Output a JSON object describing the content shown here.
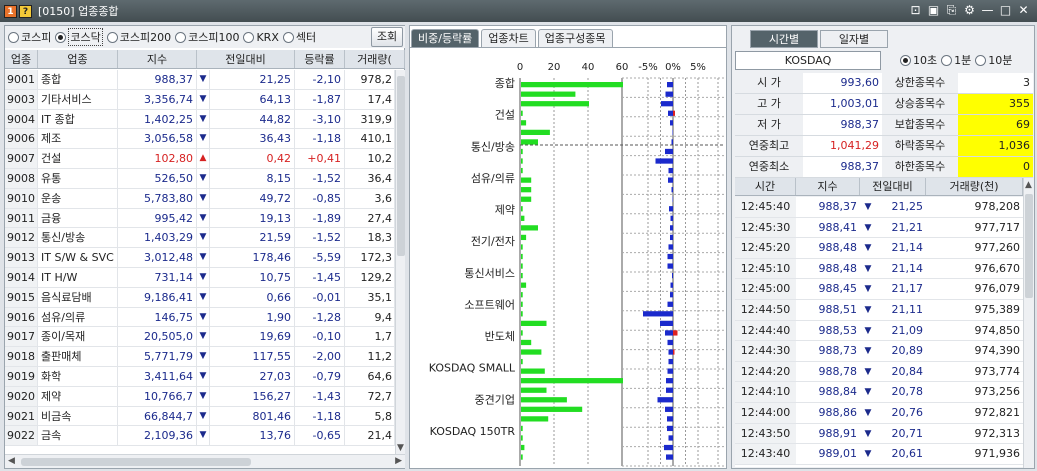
{
  "window": {
    "title": "[0150] 업종종합",
    "badge_1": "1",
    "badge_2": "?",
    "controls": [
      "⊡",
      "▣",
      "⎘",
      "⚙",
      "—",
      "□",
      "✕"
    ]
  },
  "left_panel": {
    "market_options": [
      {
        "label": "코스피",
        "selected": false
      },
      {
        "label": "코스닥",
        "selected": true
      },
      {
        "label": "코스피200",
        "selected": false
      },
      {
        "label": "코스피100",
        "selected": false
      },
      {
        "label": "KRX",
        "selected": false
      },
      {
        "label": "섹터",
        "selected": false
      }
    ],
    "query_button": "조회",
    "columns": [
      "업종",
      "업종",
      "지수",
      "전일대비",
      "등락률",
      "거래량("
    ],
    "rows": [
      {
        "code": "9001",
        "name": "종합",
        "index": "988,37",
        "dir": "down",
        "change": "21,25",
        "pct": "-2,10",
        "vol": "978,2"
      },
      {
        "code": "9003",
        "name": "기타서비스",
        "index": "3,356,74",
        "dir": "down",
        "change": "64,13",
        "pct": "-1,87",
        "vol": "17,4"
      },
      {
        "code": "9004",
        "name": "IT 종합",
        "index": "1,402,25",
        "dir": "down",
        "change": "44,82",
        "pct": "-3,10",
        "vol": "319,9"
      },
      {
        "code": "9006",
        "name": "제조",
        "index": "3,056,58",
        "dir": "down",
        "change": "36,43",
        "pct": "-1,18",
        "vol": "410,1"
      },
      {
        "code": "9007",
        "name": "건설",
        "index": "102,80",
        "dir": "up",
        "change": "0,42",
        "pct": "+0,41",
        "vol": "10,2"
      },
      {
        "code": "9008",
        "name": "유통",
        "index": "526,50",
        "dir": "down",
        "change": "8,15",
        "pct": "-1,52",
        "vol": "36,4"
      },
      {
        "code": "9010",
        "name": "운송",
        "index": "5,783,80",
        "dir": "down",
        "change": "49,72",
        "pct": "-0,85",
        "vol": "3,6"
      },
      {
        "code": "9011",
        "name": "금융",
        "index": "995,42",
        "dir": "down",
        "change": "19,13",
        "pct": "-1,89",
        "vol": "27,4"
      },
      {
        "code": "9012",
        "name": "통신/방송",
        "index": "1,403,29",
        "dir": "down",
        "change": "21,59",
        "pct": "-1,52",
        "vol": "18,3"
      },
      {
        "code": "9013",
        "name": "IT S/W & SVC",
        "index": "3,012,48",
        "dir": "down",
        "change": "178,46",
        "pct": "-5,59",
        "vol": "172,3"
      },
      {
        "code": "9014",
        "name": "IT H/W",
        "index": "731,14",
        "dir": "down",
        "change": "10,75",
        "pct": "-1,45",
        "vol": "129,2"
      },
      {
        "code": "9015",
        "name": "음식료담배",
        "index": "9,186,41",
        "dir": "down",
        "change": "0,66",
        "pct": "-0,01",
        "vol": "35,1"
      },
      {
        "code": "9016",
        "name": "섬유/의류",
        "index": "146,75",
        "dir": "down",
        "change": "1,90",
        "pct": "-1,28",
        "vol": "9,4"
      },
      {
        "code": "9017",
        "name": "종이/목재",
        "index": "20,505,0",
        "dir": "down",
        "change": "19,69",
        "pct": "-0,10",
        "vol": "1,7"
      },
      {
        "code": "9018",
        "name": "출판매체",
        "index": "5,771,79",
        "dir": "down",
        "change": "117,55",
        "pct": "-2,00",
        "vol": "11,2"
      },
      {
        "code": "9019",
        "name": "화학",
        "index": "3,411,64",
        "dir": "down",
        "change": "27,03",
        "pct": "-0,79",
        "vol": "64,6"
      },
      {
        "code": "9020",
        "name": "제약",
        "index": "10,766,7",
        "dir": "down",
        "change": "156,27",
        "pct": "-1,43",
        "vol": "72,7"
      },
      {
        "code": "9021",
        "name": "비금속",
        "index": "66,844,7",
        "dir": "down",
        "change": "801,46",
        "pct": "-1,18",
        "vol": "5,8"
      },
      {
        "code": "9022",
        "name": "금속",
        "index": "2,109,36",
        "dir": "down",
        "change": "13,76",
        "pct": "-0,65",
        "vol": "21,4"
      }
    ]
  },
  "middle_panel": {
    "tabs": [
      {
        "label": "비중/등락률",
        "active": true
      },
      {
        "label": "업종차트",
        "active": false
      },
      {
        "label": "업종구성종목",
        "active": false
      }
    ]
  },
  "chart_data": {
    "type": "bar",
    "categories": [
      "종합",
      "건설",
      "통신/방송",
      "섬유/의류",
      "제약",
      "전기/전자",
      "통신서비스",
      "소프트웨어",
      "반도체",
      "KOSDAQ SMALL",
      "중견기업",
      "KOSDAQ 150TR"
    ],
    "weight_axis": {
      "ticks": [
        "0",
        "20",
        "40",
        "60"
      ],
      "range": [
        0,
        60
      ]
    },
    "change_axis": {
      "ticks": [
        "-5%",
        "0%",
        "5%"
      ],
      "range": [
        -5,
        5
      ]
    },
    "series": [
      {
        "kind": "weight",
        "color": "#22dd22",
        "values": [
          60,
          32,
          40,
          1,
          3,
          17,
          10,
          1,
          1,
          1,
          6,
          6,
          6,
          1,
          2,
          10,
          3,
          1,
          1,
          1,
          1,
          3,
          1,
          1,
          1,
          15,
          1,
          6,
          12,
          1,
          14,
          60,
          15,
          27,
          36,
          16,
          1,
          1,
          2,
          1
        ]
      },
      {
        "kind": "change",
        "color": "#1b2acc",
        "values": [
          -1.2,
          -1.5,
          -2.4,
          -1.0,
          -0.6,
          -0.1,
          -0.3,
          -1.6,
          -3.5,
          -0.9,
          -1.0,
          -0.3,
          -0.1,
          -0.8,
          -0.5,
          -0.6,
          -0.6,
          -0.9,
          -1.1,
          -1.1,
          -0.2,
          -0.5,
          -0.6,
          -1.1,
          -6.0,
          -2.6,
          -1.6,
          -1.1,
          -0.9,
          -0.9,
          -1.1,
          -1.4,
          -1.4,
          -3.1,
          -1.6,
          -1.2,
          -1.2,
          -0.9,
          -1.8,
          -1.4
        ]
      },
      {
        "kind": "change-positive",
        "color": "#dd2222",
        "values": [
          0,
          0,
          0,
          0.4,
          0,
          0,
          0,
          0,
          0,
          0,
          0,
          0,
          0,
          0,
          0,
          0,
          0,
          0,
          0,
          0,
          0,
          0,
          0,
          0,
          0,
          0,
          0.9,
          0,
          0.3,
          0,
          0,
          0,
          0,
          0,
          0,
          0,
          0,
          0,
          0,
          0
        ]
      }
    ]
  },
  "right_panel": {
    "tabs": [
      {
        "label": "시간별",
        "active": true
      },
      {
        "label": "일자별",
        "active": false
      }
    ],
    "market": "KOSDAQ",
    "interval_options": [
      {
        "label": "10초",
        "selected": true
      },
      {
        "label": "1분",
        "selected": false
      },
      {
        "label": "10분",
        "selected": false
      }
    ],
    "stats": [
      {
        "label": "시  가",
        "value": "993,60",
        "up": false,
        "label2": "상한종목수",
        "value2": "3",
        "hl": false
      },
      {
        "label": "고  가",
        "value": "1,003,01",
        "up": false,
        "label2": "상승종목수",
        "value2": "355",
        "hl": true
      },
      {
        "label": "저  가",
        "value": "988,37",
        "up": false,
        "label2": "보합종목수",
        "value2": "69",
        "hl": true
      },
      {
        "label": "연중최고",
        "value": "1,041,29",
        "up": true,
        "label2": "하락종목수",
        "value2": "1,036",
        "hl": true
      },
      {
        "label": "연중최소",
        "value": "988,37",
        "up": false,
        "label2": "하한종목수",
        "value2": "0",
        "hl": true
      }
    ],
    "columns": [
      "시간",
      "지수",
      "전일대비",
      "거래량(천)"
    ],
    "rows": [
      {
        "time": "12:45:40",
        "index": "988,37",
        "change": "21,25",
        "vol": "978,208"
      },
      {
        "time": "12:45:30",
        "index": "988,41",
        "change": "21,21",
        "vol": "977,717"
      },
      {
        "time": "12:45:20",
        "index": "988,48",
        "change": "21,14",
        "vol": "977,260"
      },
      {
        "time": "12:45:10",
        "index": "988,48",
        "change": "21,14",
        "vol": "976,670"
      },
      {
        "time": "12:45:00",
        "index": "988,45",
        "change": "21,17",
        "vol": "976,079"
      },
      {
        "time": "12:44:50",
        "index": "988,51",
        "change": "21,11",
        "vol": "975,389"
      },
      {
        "time": "12:44:40",
        "index": "988,53",
        "change": "21,09",
        "vol": "974,850"
      },
      {
        "time": "12:44:30",
        "index": "988,73",
        "change": "20,89",
        "vol": "974,390"
      },
      {
        "time": "12:44:20",
        "index": "988,78",
        "change": "20,84",
        "vol": "973,774"
      },
      {
        "time": "12:44:10",
        "index": "988,84",
        "change": "20,78",
        "vol": "973,256"
      },
      {
        "time": "12:44:00",
        "index": "988,86",
        "change": "20,76",
        "vol": "972,821"
      },
      {
        "time": "12:43:50",
        "index": "988,91",
        "change": "20,71",
        "vol": "972,313"
      },
      {
        "time": "12:43:40",
        "index": "989,01",
        "change": "20,61",
        "vol": "971,936"
      }
    ]
  }
}
